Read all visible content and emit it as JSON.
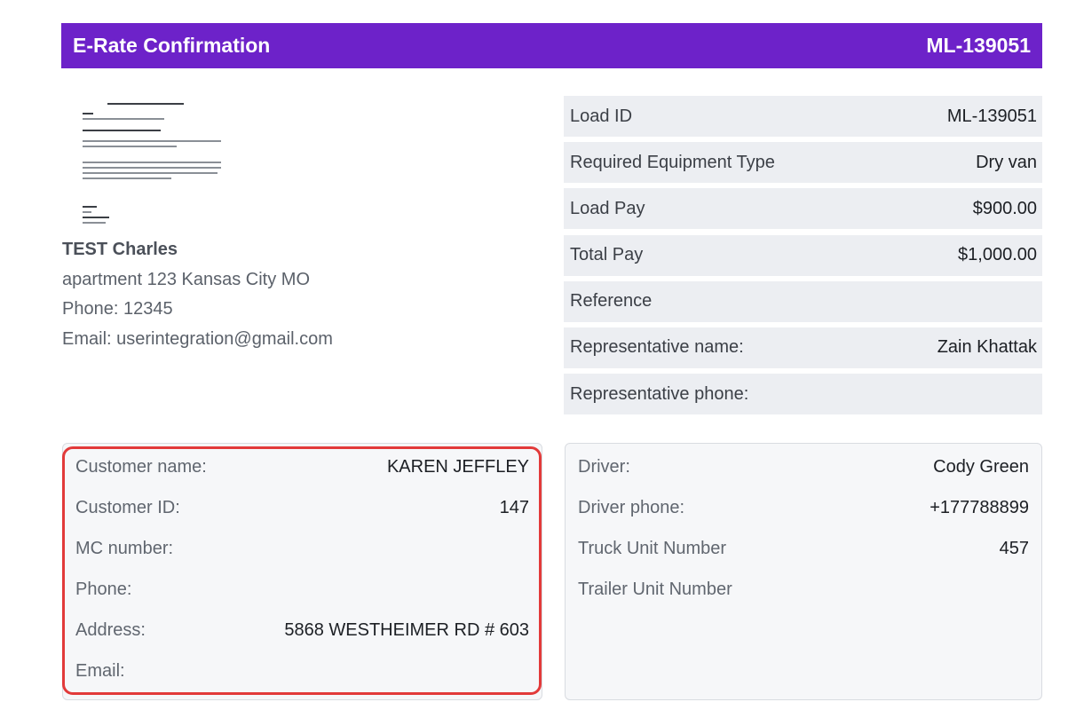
{
  "header": {
    "title": "E-Rate Confirmation",
    "load_number": "ML-139051"
  },
  "company": {
    "name": "TEST Charles",
    "address": "apartment 123 Kansas City MO",
    "phone": "Phone: 12345",
    "email": "Email: userintegration@gmail.com"
  },
  "load_info": [
    {
      "label": "Load ID",
      "value": "ML-139051"
    },
    {
      "label": "Required Equipment Type",
      "value": "Dry van"
    },
    {
      "label": "Load Pay",
      "value": "$900.00"
    },
    {
      "label": "Total Pay",
      "value": "$1,000.00"
    },
    {
      "label": "Reference",
      "value": ""
    },
    {
      "label": "Representative name:",
      "value": "Zain Khattak"
    },
    {
      "label": "Representative phone:",
      "value": ""
    }
  ],
  "customer": [
    {
      "label": "Customer name:",
      "value": "KAREN JEFFLEY"
    },
    {
      "label": "Customer ID:",
      "value": "147"
    },
    {
      "label": "MC number:",
      "value": ""
    },
    {
      "label": "Phone:",
      "value": ""
    },
    {
      "label": "Address:",
      "value": "5868 WESTHEIMER RD # 603"
    },
    {
      "label": "Email:",
      "value": ""
    }
  ],
  "driver": [
    {
      "label": "Driver:",
      "value": "Cody Green"
    },
    {
      "label": "Driver phone:",
      "value": "+177788899"
    },
    {
      "label": "Truck Unit Number",
      "value": "457"
    },
    {
      "label": "Trailer Unit Number",
      "value": ""
    }
  ],
  "colors": {
    "banner": "#6d22c9",
    "highlight": "#e23a3a",
    "row_bg": "#eceef2"
  }
}
